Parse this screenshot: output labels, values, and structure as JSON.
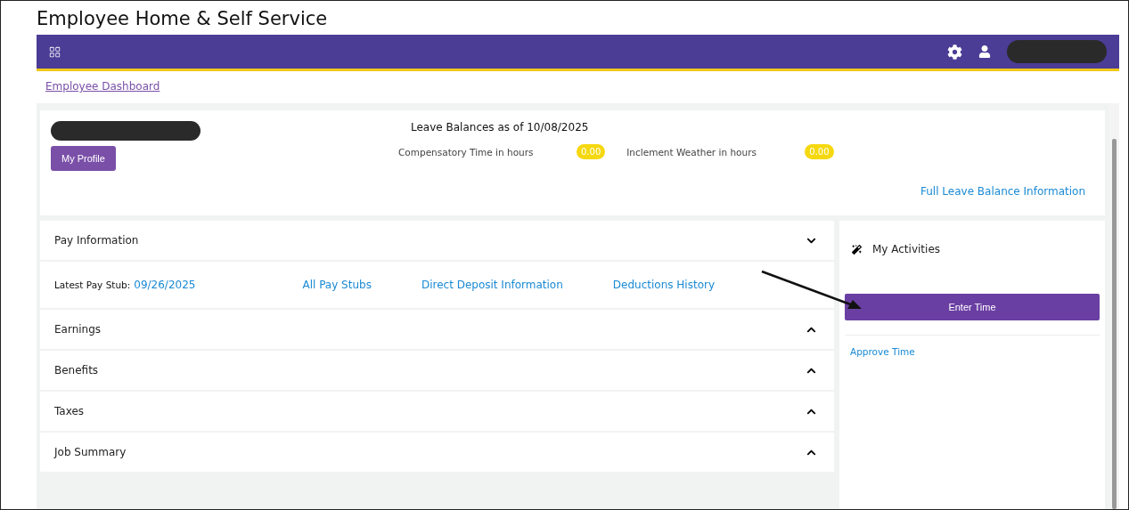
{
  "window": {
    "title": "Employee Home & Self Service"
  },
  "breadcrumb": "Employee Dashboard",
  "profile": {
    "button": "My Profile"
  },
  "leave": {
    "title": "Leave Balances as of 10/08/2025",
    "balances": [
      {
        "label": "Compensatory Time in hours",
        "value": "0.00"
      },
      {
        "label": "Inclement Weather in hours",
        "value": "0.00"
      }
    ],
    "link": "Full Leave Balance Information"
  },
  "sections": [
    {
      "title": "Pay Information",
      "expanded": true,
      "latest_label": "Latest Pay Stub:",
      "latest_date": "09/26/2025",
      "links": [
        "All Pay Stubs",
        "Direct Deposit Information",
        "Deductions History"
      ]
    },
    {
      "title": "Earnings",
      "expanded": false
    },
    {
      "title": "Benefits",
      "expanded": false
    },
    {
      "title": "Taxes",
      "expanded": false
    },
    {
      "title": "Job Summary",
      "expanded": false
    }
  ],
  "activities": {
    "title": "My Activities",
    "button": "Enter Time",
    "link": "Approve Time"
  }
}
